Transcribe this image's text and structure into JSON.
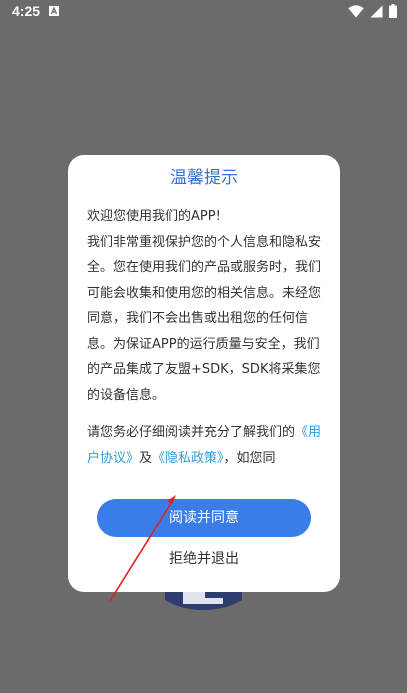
{
  "status_bar": {
    "time": "4:25"
  },
  "dialog": {
    "title": "温馨提示",
    "intro": "欢迎您使用我们的APP!",
    "paragraph": "我们非常重视保护您的个人信息和隐私安全。您在使用我们的产品或服务时，我们可能会收集和使用您的相关信息。未经您同意，我们不会出售或出租您的任何信息。为保证APP的运行质量与安全，我们的产品集成了友盟+SDK，SDK将采集您的设备信息。",
    "paragraph2_prefix": "请您务必仔细阅读并充分了解我们的",
    "user_agreement_link": "《用户协议》",
    "and_text": "及",
    "privacy_policy_link": "《隐私政策》",
    "trailing_text": "，如您同",
    "agree_label": "阅读并同意",
    "exit_label": "拒绝并退出"
  },
  "colors": {
    "overlay": "#6b6b6b",
    "title": "#3a6fd6",
    "button": "#3b7de6",
    "link": "#2f9bdc",
    "arrow": "#e02020"
  },
  "icons": [
    "notification-a-icon",
    "wifi-icon",
    "signal-icon",
    "battery-icon"
  ]
}
